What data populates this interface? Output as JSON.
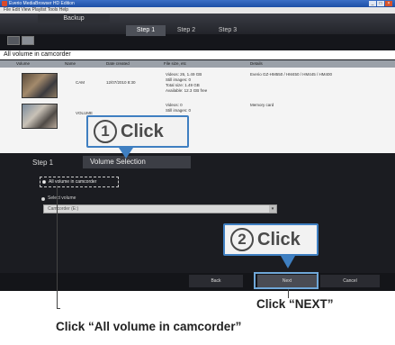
{
  "window": {
    "title": "Everio MediaBrowser HD Edition"
  },
  "menubar": {
    "text": "File Edit View Playlist Tools Help"
  },
  "header": {
    "backup_tab": "Backup",
    "steps": [
      "Step 1",
      "Step 2",
      "Step 3"
    ]
  },
  "list": {
    "title": "All volume in camcorder",
    "columns": [
      "Volume",
      "Name",
      "Date created",
      "File size, etc",
      "Details"
    ],
    "rows": [
      {
        "name": "CAM",
        "date": "12/07/2010 8:30",
        "info": [
          "Videos: 26, 1.49 GB",
          "Still images: 0",
          "Total size: 1.49 GB",
          "Available: 12.3 GB free"
        ],
        "details": "Everio GZ-HM550 / HM450 / HM445 / HM400"
      },
      {
        "name": "VOLUME",
        "date": "",
        "info": [
          "Videos: 0",
          "Still images: 0"
        ],
        "details": "Memory card"
      }
    ]
  },
  "lower": {
    "step_label": "Step 1",
    "volume_tab": "Volume Selection",
    "option_all": "All volume in camcorder",
    "option_select": "Select volume",
    "select_value": "Camcorder (E:)"
  },
  "footer": {
    "back": "Back",
    "next": "Next",
    "cancel": "Cancel"
  },
  "callouts": {
    "step1": {
      "num": "1",
      "text": "Click"
    },
    "step2": {
      "num": "2",
      "text": "Click"
    }
  },
  "captions": {
    "next": "Click “NEXT”",
    "all_volume": "Click “All volume in camcorder”"
  },
  "colors": {
    "callout_border": "#3f7fc1",
    "app_bg": "#15161b"
  }
}
